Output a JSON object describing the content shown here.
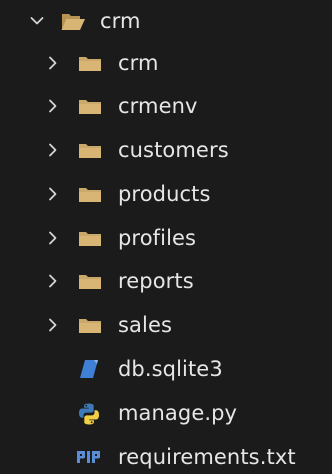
{
  "root": {
    "label": "crm",
    "expanded": true,
    "icon": "folder-open-icon"
  },
  "children": [
    {
      "label": "crm",
      "type": "folder",
      "icon": "folder-icon"
    },
    {
      "label": "crmenv",
      "type": "folder",
      "icon": "folder-icon"
    },
    {
      "label": "customers",
      "type": "folder",
      "icon": "folder-icon"
    },
    {
      "label": "products",
      "type": "folder",
      "icon": "folder-icon"
    },
    {
      "label": "profiles",
      "type": "folder",
      "icon": "folder-icon"
    },
    {
      "label": "reports",
      "type": "folder",
      "icon": "folder-icon"
    },
    {
      "label": "sales",
      "type": "folder",
      "icon": "folder-icon"
    },
    {
      "label": "db.sqlite3",
      "type": "file",
      "icon": "database-file-icon"
    },
    {
      "label": "manage.py",
      "type": "file",
      "icon": "python-icon"
    },
    {
      "label": "requirements.txt",
      "type": "file",
      "icon": "pip-requirements-icon"
    }
  ],
  "colors": {
    "background": "#1b1b1b",
    "text": "#e6e6e6",
    "chevron": "#d4d4d4",
    "folder": "#c9a86a",
    "database": "#3f7fd6",
    "python_blue": "#3d7ab8",
    "python_yellow": "#f2cf44",
    "pip": "#5a8dd6"
  }
}
